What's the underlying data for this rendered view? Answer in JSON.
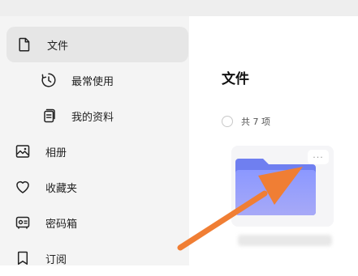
{
  "sidebar": {
    "items": [
      {
        "label": "文件",
        "icon": "file-icon",
        "active": true
      },
      {
        "label": "最常使用",
        "icon": "clock-icon",
        "active": false
      },
      {
        "label": "我的资料",
        "icon": "documents-icon",
        "active": false
      },
      {
        "label": "相册",
        "icon": "photo-icon",
        "active": false
      },
      {
        "label": "收藏夹",
        "icon": "heart-icon",
        "active": false
      },
      {
        "label": "密码箱",
        "icon": "safe-icon",
        "active": false
      },
      {
        "label": "订阅",
        "icon": "bookmark-icon",
        "active": false
      }
    ]
  },
  "main": {
    "title": "文件",
    "count_text": "共 7 项",
    "folder": {
      "more_label": "···",
      "folder_color": "#7f8dfb"
    }
  },
  "colors": {
    "sidebar_bg": "#f4f4f4",
    "active_bg": "#e6e6e6",
    "arrow": "#f07e34"
  }
}
